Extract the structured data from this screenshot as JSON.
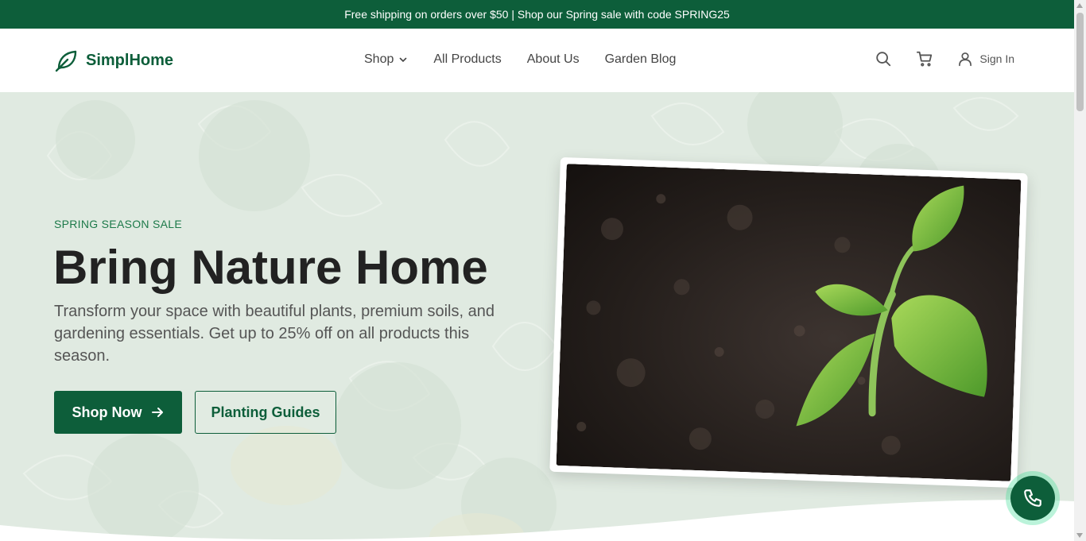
{
  "announcement": "Free shipping on orders over $50 | Shop our Spring sale with code SPRING25",
  "brand": {
    "name": "SimplHome",
    "logo_icon": "leaf-icon",
    "color": "#0d5e3a"
  },
  "nav": [
    {
      "label": "Shop",
      "has_dropdown": true
    },
    {
      "label": "All Products"
    },
    {
      "label": "About Us"
    },
    {
      "label": "Garden Blog"
    }
  ],
  "tools": {
    "search_icon": "search-icon",
    "cart_icon": "cart-icon",
    "user_icon": "user-icon",
    "signin_label": "Sign In"
  },
  "hero": {
    "tag": "SPRING SEASON SALE",
    "headline": "Bring Nature Home",
    "subtext": "Transform your space with beautiful plants, premium soils, and gardening essentials. Get up to 25% off on all products this season.",
    "primary_button": "Shop Now",
    "secondary_button": "Planting Guides"
  },
  "floating": {
    "call_icon": "phone-icon"
  },
  "colors": {
    "accent": "#0d5e3a",
    "tag": "#1d7a4a",
    "hero_bg": "#dfe9e0"
  }
}
